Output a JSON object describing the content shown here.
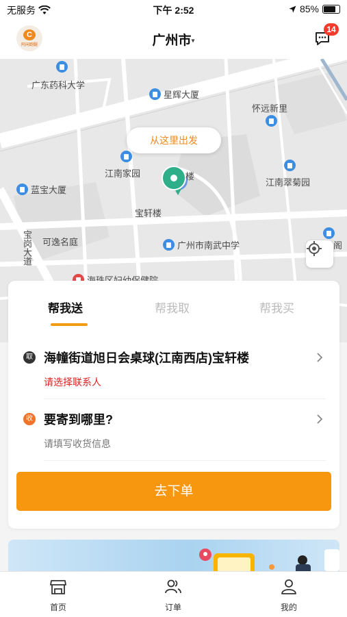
{
  "status": {
    "carrier": "无服务",
    "time": "下午 2:52",
    "battery_percent": "85%",
    "battery_level": 0.85
  },
  "header": {
    "logo_text": "阿闲跑腿",
    "city": "广州市",
    "caret": "▾",
    "message_badge": "14"
  },
  "map": {
    "pois": [
      "广东药科大学",
      "星辉大厦",
      "怀远新里",
      "江南家园",
      "楼",
      "江南翠菊园",
      "蓝宝大厦",
      "宝轩楼",
      "可逸名庭",
      "广州市南武中学",
      "海珠区妇幼保健院",
      "阁",
      "宝岗大道"
    ],
    "start_bubble": "从这里出发"
  },
  "tabs": [
    {
      "label": "帮我送",
      "active": true
    },
    {
      "label": "帮我取",
      "active": false
    },
    {
      "label": "帮我买",
      "active": false
    }
  ],
  "pickup": {
    "badge": "取",
    "address": "海幢街道旭日会桌球(江南西店)宝轩楼",
    "hint": "请选择联系人"
  },
  "delivery": {
    "badge": "收",
    "title": "要寄到哪里?",
    "hint": "请填写收货信息"
  },
  "submit_label": "去下单",
  "tabbar": [
    {
      "label": "首页",
      "icon": "storefront-icon"
    },
    {
      "label": "订单",
      "icon": "users-icon"
    },
    {
      "label": "我的",
      "icon": "person-icon"
    }
  ],
  "colors": {
    "accent": "#f7960f",
    "warn": "#e02020",
    "badge": "#f23b2d",
    "pin": "#2fae8a",
    "poi": "#3d8ee0"
  }
}
